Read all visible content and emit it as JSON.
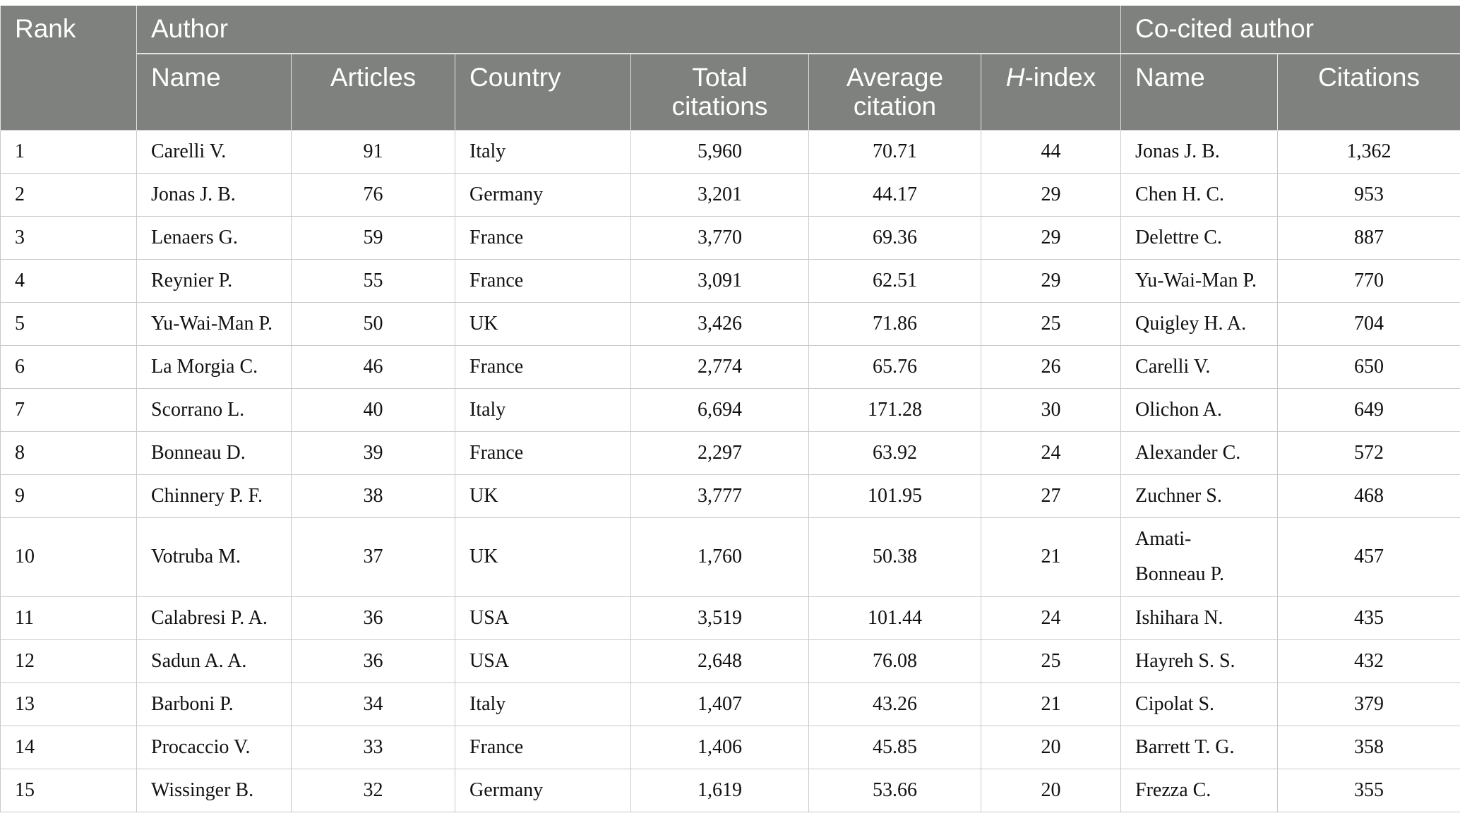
{
  "header": {
    "rank": "Rank",
    "author_group": "Author",
    "cocited_group": "Co-cited author",
    "columns": {
      "name": "Name",
      "articles": "Articles",
      "country": "Country",
      "total_citations": "Total citations",
      "average_citation": "Average citation",
      "h_index_italic": "H",
      "h_index_rest": "-index",
      "cocited_name": "Name",
      "citations": "Citations"
    }
  },
  "rows": [
    {
      "rank": "1",
      "name": "Carelli V.",
      "articles": "91",
      "country": "Italy",
      "total": "5,960",
      "avg": "70.71",
      "h": "44",
      "cname": "Jonas J. B.",
      "citations": "1,362"
    },
    {
      "rank": "2",
      "name": "Jonas J. B.",
      "articles": "76",
      "country": "Germany",
      "total": "3,201",
      "avg": "44.17",
      "h": "29",
      "cname": "Chen H. C.",
      "citations": "953"
    },
    {
      "rank": "3",
      "name": "Lenaers G.",
      "articles": "59",
      "country": "France",
      "total": "3,770",
      "avg": "69.36",
      "h": "29",
      "cname": "Delettre C.",
      "citations": "887"
    },
    {
      "rank": "4",
      "name": "Reynier P.",
      "articles": "55",
      "country": "France",
      "total": "3,091",
      "avg": "62.51",
      "h": "29",
      "cname": "Yu-Wai-Man P.",
      "citations": "770"
    },
    {
      "rank": "5",
      "name": "Yu-Wai-Man P.",
      "articles": "50",
      "country": "UK",
      "total": "3,426",
      "avg": "71.86",
      "h": "25",
      "cname": "Quigley H. A.",
      "citations": "704"
    },
    {
      "rank": "6",
      "name": "La Morgia C.",
      "articles": "46",
      "country": "France",
      "total": "2,774",
      "avg": "65.76",
      "h": "26",
      "cname": "Carelli V.",
      "citations": "650"
    },
    {
      "rank": "7",
      "name": "Scorrano L.",
      "articles": "40",
      "country": "Italy",
      "total": "6,694",
      "avg": "171.28",
      "h": "30",
      "cname": "Olichon A.",
      "citations": "649"
    },
    {
      "rank": "8",
      "name": "Bonneau D.",
      "articles": "39",
      "country": "France",
      "total": "2,297",
      "avg": "63.92",
      "h": "24",
      "cname": "Alexander C.",
      "citations": "572"
    },
    {
      "rank": "9",
      "name": "Chinnery P. F.",
      "articles": "38",
      "country": "UK",
      "total": "3,777",
      "avg": "101.95",
      "h": "27",
      "cname": "Zuchner S.",
      "citations": "468"
    },
    {
      "rank": "10",
      "name": "Votruba M.",
      "articles": "37",
      "country": "UK",
      "total": "1,760",
      "avg": "50.38",
      "h": "21",
      "cname": "Amati-Bonneau P.",
      "citations": "457"
    },
    {
      "rank": "11",
      "name": "Calabresi P. A.",
      "articles": "36",
      "country": "USA",
      "total": "3,519",
      "avg": "101.44",
      "h": "24",
      "cname": "Ishihara N.",
      "citations": "435"
    },
    {
      "rank": "12",
      "name": "Sadun A. A.",
      "articles": "36",
      "country": "USA",
      "total": "2,648",
      "avg": "76.08",
      "h": "25",
      "cname": "Hayreh S. S.",
      "citations": "432"
    },
    {
      "rank": "13",
      "name": "Barboni P.",
      "articles": "34",
      "country": "Italy",
      "total": "1,407",
      "avg": "43.26",
      "h": "21",
      "cname": "Cipolat S.",
      "citations": "379"
    },
    {
      "rank": "14",
      "name": "Procaccio V.",
      "articles": "33",
      "country": "France",
      "total": "1,406",
      "avg": "45.85",
      "h": "20",
      "cname": "Barrett T. G.",
      "citations": "358"
    },
    {
      "rank": "15",
      "name": "Wissinger B.",
      "articles": "32",
      "country": "Germany",
      "total": "1,619",
      "avg": "53.66",
      "h": "20",
      "cname": "Frezza C.",
      "citations": "355"
    }
  ]
}
